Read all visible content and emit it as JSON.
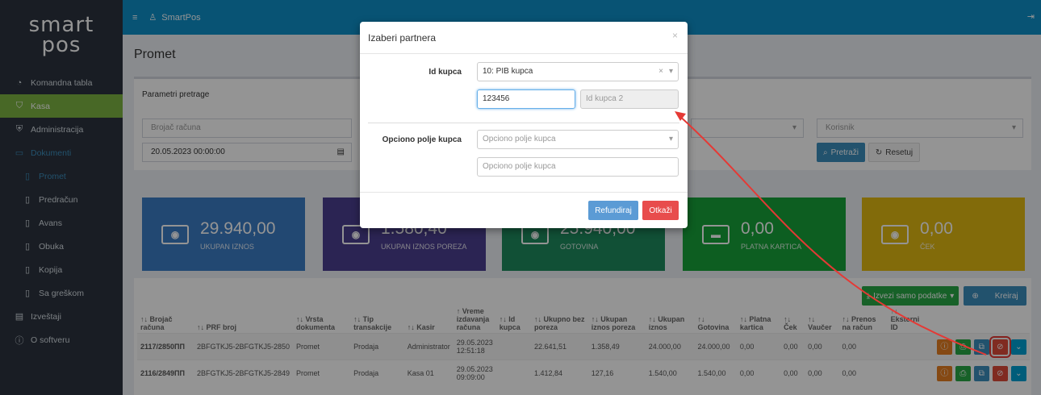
{
  "logo": {
    "line1": "smart",
    "line2": "pos"
  },
  "sidebar": {
    "items": [
      {
        "label": "Komandna tabla"
      },
      {
        "label": "Kasa"
      },
      {
        "label": "Administracija"
      },
      {
        "label": "Dokumenti"
      },
      {
        "label": "Promet"
      },
      {
        "label": "Predračun"
      },
      {
        "label": "Avans"
      },
      {
        "label": "Obuka"
      },
      {
        "label": "Kopija"
      },
      {
        "label": "Sa greškom"
      },
      {
        "label": "Izveštaji"
      },
      {
        "label": "O softveru"
      }
    ]
  },
  "topbar": {
    "app_name": "SmartPos"
  },
  "page": {
    "title": "Promet"
  },
  "search": {
    "header": "Parametri pretrage",
    "receipt_placeholder": "Brojač računa",
    "date_value": "20.05.2023 00:00:00",
    "user_placeholder": "Korisnik",
    "search_label": "Pretraži",
    "reset_label": "Resetuj"
  },
  "tiles": [
    {
      "value": "29.940,00",
      "label": "UKUPAN IZNOS",
      "color": "#3c7dc4"
    },
    {
      "value": "1.580,40",
      "label": "UKUPAN IZNOS POREZA",
      "color": "#4b3f8f"
    },
    {
      "value": "25.940,00",
      "label": "GOTOVINA",
      "color": "#1e8a5e"
    },
    {
      "value": "0,00",
      "label": "PLATNA KARTICA",
      "color": "#17a33a"
    },
    {
      "value": "0,00",
      "label": "ČEK",
      "color": "#e0b812"
    }
  ],
  "actions": {
    "export_label": "Izvezi samo podatke",
    "create_label": "Kreiraj"
  },
  "table": {
    "headers": [
      "Brojač računa",
      "PRF broj",
      "Vrsta dokumenta",
      "Tip transakcije",
      "Kasir",
      "Vreme izdavanja računa",
      "Id kupca",
      "Ukupno bez poreza",
      "Ukupan iznos poreza",
      "Ukupan iznos",
      "Gotovina",
      "Platna kartica",
      "Ček",
      "Vaučer",
      "Prenos na račun",
      "Eksterni ID"
    ],
    "rows": [
      [
        "2117/2850ПП",
        "2BFGTKJ5-2BFGTKJ5-2850",
        "Promet",
        "Prodaja",
        "Administrator",
        "29.05.2023 12:51:18",
        "",
        "22.641,51",
        "1.358,49",
        "24.000,00",
        "24.000,00",
        "0,00",
        "0,00",
        "0,00",
        "0,00",
        ""
      ],
      [
        "2116/2849ПП",
        "2BFGTKJ5-2BFGTKJ5-2849",
        "Promet",
        "Prodaja",
        "Kasa 01",
        "29.05.2023 09:09:00",
        "",
        "1.412,84",
        "127,16",
        "1.540,00",
        "1.540,00",
        "0,00",
        "0,00",
        "0,00",
        "0,00",
        ""
      ]
    ]
  },
  "modal": {
    "title": "Izaberi partnera",
    "id_label": "Id kupca",
    "id_select_value": "10: PIB kupca",
    "id_input_value": "123456",
    "id2_placeholder": "Id kupca 2",
    "optional_label": "Opciono polje kupca",
    "optional_select_placeholder": "Opciono polje kupca",
    "optional_input_placeholder": "Opciono polje kupca",
    "refund_label": "Refundiraj",
    "cancel_label": "Otkaži"
  },
  "colors": {
    "topbar": "#0e8fc9",
    "sidebar": "#2b333e",
    "kasa_active": "#7cb342",
    "annotation": "#e53935"
  }
}
